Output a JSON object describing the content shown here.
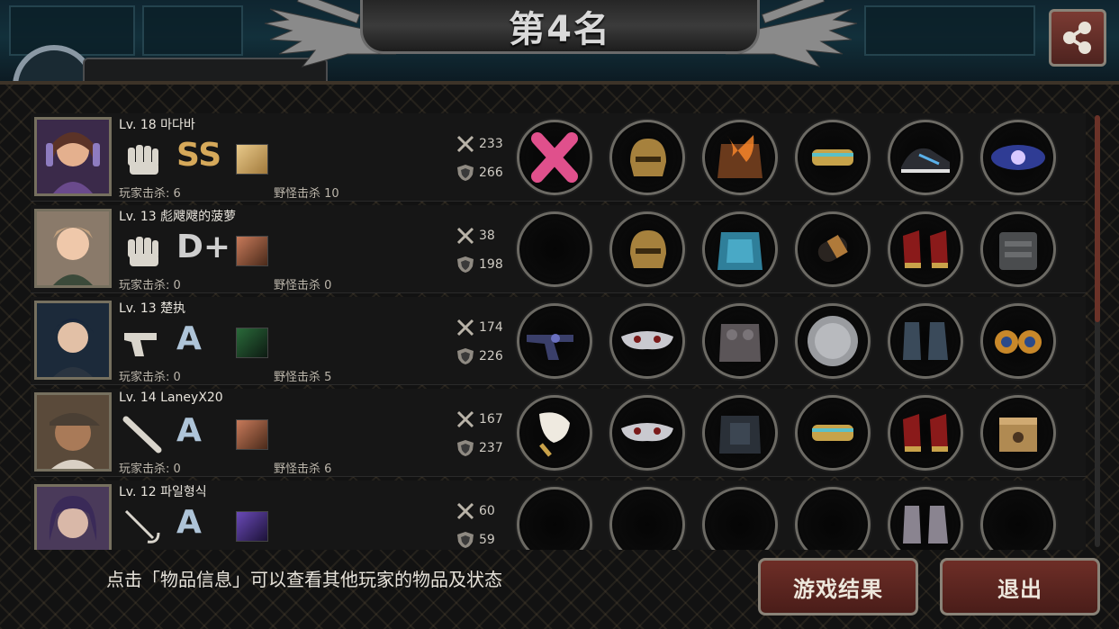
{
  "header": {
    "title": "第4名",
    "share_icon": "share-icon"
  },
  "colors": {
    "button": "#5a2520",
    "grade_ss": "#d6a95a",
    "grade_a": "#aec4d8"
  },
  "players": [
    {
      "level": "Lv. 18 마다바",
      "weapon_icon": "fist-icon",
      "grade": "SS",
      "atk": "233",
      "def": "266",
      "pvp_kills": "玩家击杀: 6",
      "pve_kills": "野怪击杀 10",
      "items": [
        "pink-cross-gloves",
        "gold-helmet",
        "flaming-armor",
        "gold-bracelet",
        "sneakers",
        "galaxy-orb"
      ]
    },
    {
      "level": "Lv. 13 彪飕飕的菠萝",
      "weapon_icon": "fist-icon",
      "grade": "D+",
      "atk": "38",
      "def": "198",
      "pvp_kills": "玩家击杀: 0",
      "pve_kills": "野怪击杀 0",
      "items": [
        "empty",
        "gold-helmet",
        "blue-armor",
        "bullet",
        "red-heels",
        "tactical-vest"
      ]
    },
    {
      "level": "Lv. 13 楚执",
      "weapon_icon": "pistol-icon",
      "grade": "A",
      "atk": "174",
      "def": "226",
      "pvp_kills": "玩家击杀: 0",
      "pve_kills": "野怪击杀 5",
      "items": [
        "revolver",
        "silver-mask",
        "stone-armor",
        "steel-disc",
        "blue-boots",
        "gold-earrings"
      ]
    },
    {
      "level": "Lv. 14 LaneyX20",
      "weapon_icon": "bat-icon",
      "grade": "A",
      "atk": "167",
      "def": "237",
      "pvp_kills": "玩家击杀: 0",
      "pve_kills": "野怪击杀 6",
      "items": [
        "white-hat",
        "silver-mask",
        "dark-armor",
        "gold-bracelet",
        "red-heels",
        "crate"
      ]
    },
    {
      "level": "Lv. 12 파일형식",
      "weapon_icon": "rapier-icon",
      "grade": "A",
      "atk": "60",
      "def": "59",
      "pvp_kills": "",
      "pve_kills": "",
      "items": [
        "empty",
        "empty",
        "empty",
        "empty",
        "grey-boots",
        "empty"
      ]
    }
  ],
  "footer": {
    "hint": "点击「物品信息」可以查看其他玩家的物品及状态",
    "result_button": "游戏结果",
    "exit_button": "退出"
  }
}
